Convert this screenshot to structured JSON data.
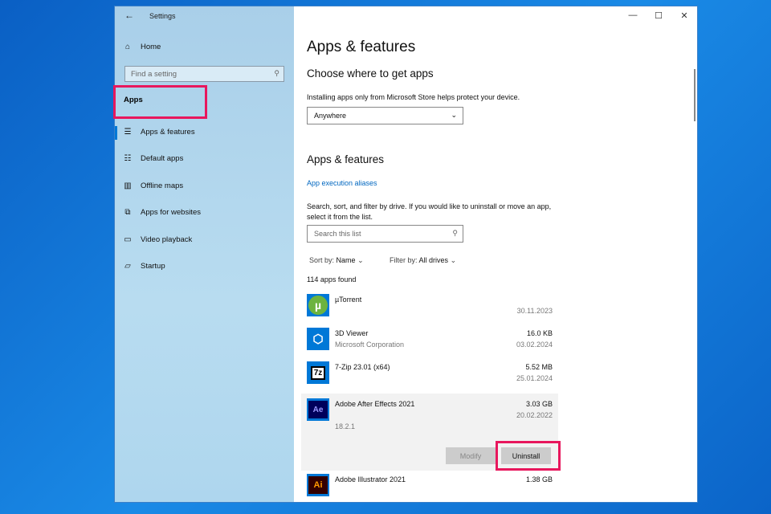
{
  "window": {
    "title": "Settings",
    "minimize": "—",
    "maximize": "☐",
    "close": "✕"
  },
  "sidebar": {
    "home": "Home",
    "search_placeholder": "Find a setting",
    "section": "Apps",
    "items": [
      {
        "label": "Apps & features",
        "icon": "☰"
      },
      {
        "label": "Default apps",
        "icon": "☷"
      },
      {
        "label": "Offline maps",
        "icon": "▥"
      },
      {
        "label": "Apps for websites",
        "icon": "⧉"
      },
      {
        "label": "Video playback",
        "icon": "▭"
      },
      {
        "label": "Startup",
        "icon": "▱"
      }
    ]
  },
  "main": {
    "title": "Apps & features",
    "choose_heading": "Choose where to get apps",
    "choose_desc": "Installing apps only from Microsoft Store helps protect your device.",
    "dropdown_value": "Anywhere",
    "section_heading": "Apps & features",
    "aliases_link": "App execution aliases",
    "search_desc": "Search, sort, and filter by drive. If you would like to uninstall or move an app, select it from the list.",
    "search_placeholder": "Search this list",
    "sort_label": "Sort by:",
    "sort_value": "Name",
    "filter_label": "Filter by:",
    "filter_value": "All drives",
    "count": "114 apps found",
    "apps": [
      {
        "name": "µTorrent",
        "publisher": "",
        "size": "",
        "date": "30.11.2023",
        "icon_text": "µ",
        "color": "#6db33f"
      },
      {
        "name": "3D Viewer",
        "publisher": "Microsoft Corporation",
        "size": "16.0 KB",
        "date": "03.02.2024",
        "icon_text": "⬡",
        "color": "#0078d7"
      },
      {
        "name": "7-Zip 23.01 (x64)",
        "publisher": "",
        "size": "5.52 MB",
        "date": "25.01.2024",
        "icon_text": "7z",
        "color": "#0078d7"
      },
      {
        "name": "Adobe After Effects 2021",
        "publisher": "",
        "size": "3.03 GB",
        "date": "20.02.2022",
        "version": "18.2.1",
        "icon_text": "Ae",
        "color": "#00005b"
      },
      {
        "name": "Adobe Illustrator 2021",
        "publisher": "",
        "size": "1.38 GB",
        "date": "",
        "icon_text": "Ai",
        "color": "#330000"
      }
    ],
    "modify": "Modify",
    "uninstall": "Uninstall"
  }
}
